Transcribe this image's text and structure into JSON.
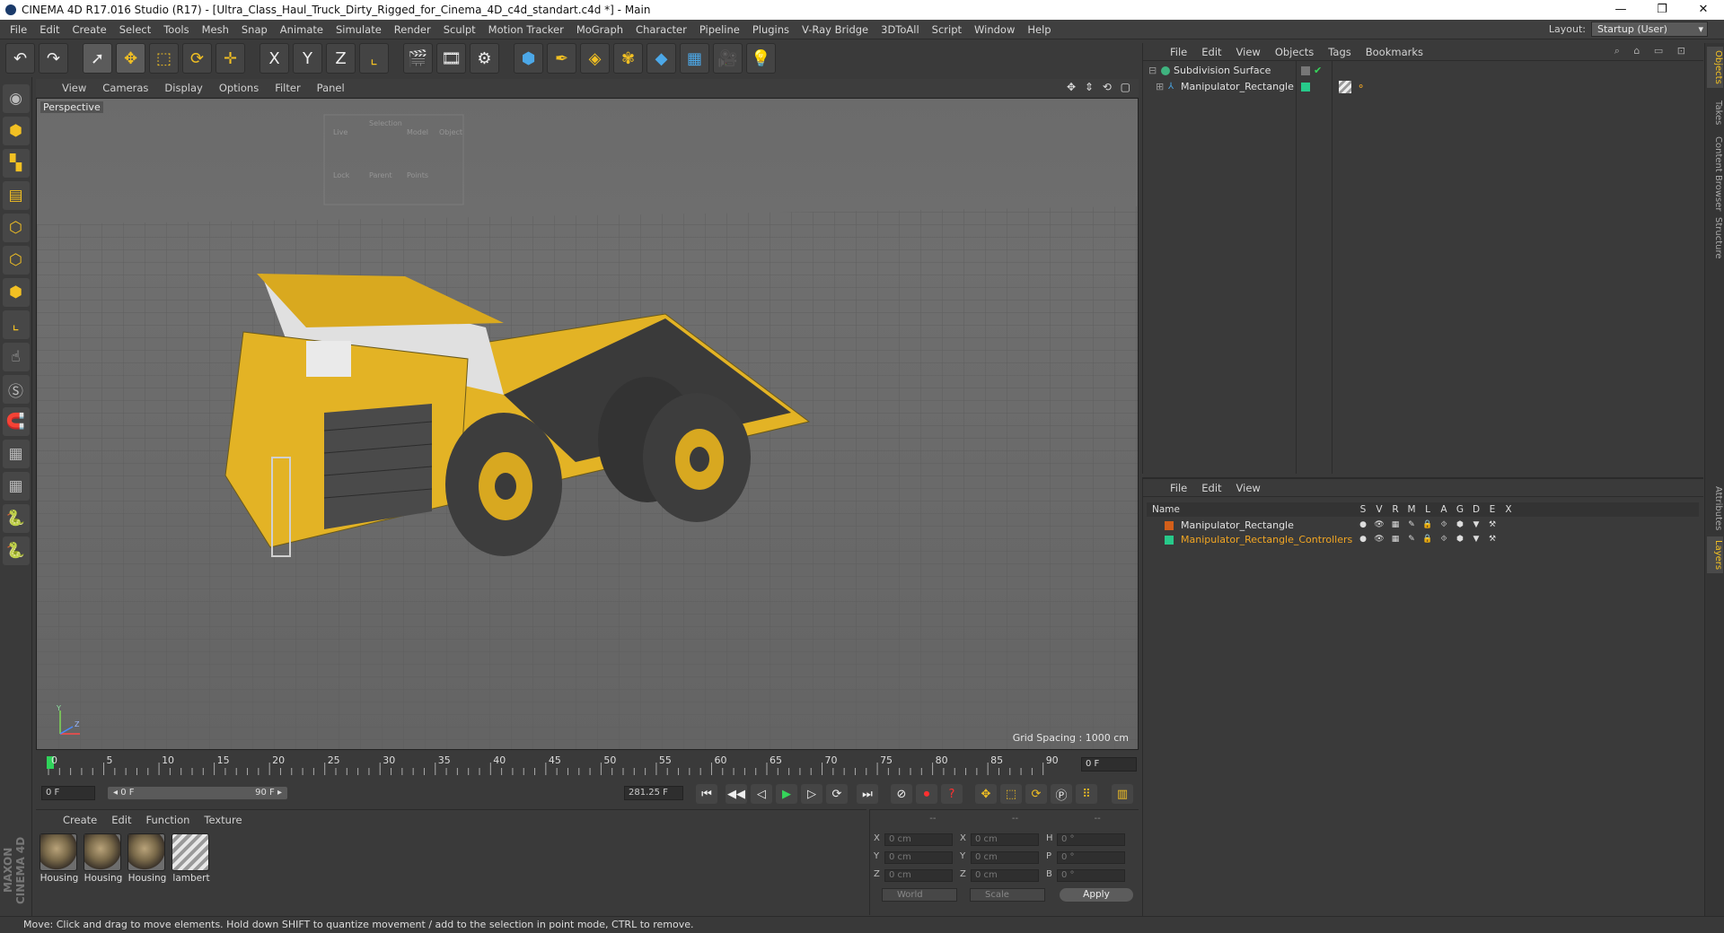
{
  "titlebar": {
    "title": "CINEMA 4D R17.016 Studio (R17) - [Ultra_Class_Haul_Truck_Dirty_Rigged_for_Cinema_4D_c4d_standart.c4d *] - Main",
    "minimize": "—",
    "maximize": "❐",
    "close": "✕"
  },
  "menubar": {
    "items": [
      "File",
      "Edit",
      "Create",
      "Select",
      "Tools",
      "Mesh",
      "Snap",
      "Animate",
      "Simulate",
      "Render",
      "Sculpt",
      "Motion Tracker",
      "MoGraph",
      "Character",
      "Pipeline",
      "Plugins",
      "V-Ray Bridge",
      "3DToAll",
      "Script",
      "Window",
      "Help"
    ],
    "layout_label": "Layout:",
    "layout_value": "Startup (User)"
  },
  "toolbar": {
    "icons": [
      "undo-icon",
      "redo-icon",
      "live-selection-icon",
      "move-icon",
      "scale-icon",
      "rotate-icon",
      "last-tool-icon",
      "x-axis-icon",
      "y-axis-icon",
      "z-axis-icon",
      "coordinate-system-icon",
      "render-view-icon",
      "render-picture-viewer-icon",
      "edit-render-settings-icon",
      "cube-icon",
      "pen-spline-icon",
      "subdivision-icon",
      "cloner-icon",
      "deformer-icon",
      "floor-icon",
      "camera-icon",
      "light-icon"
    ],
    "axis_x": "X",
    "axis_y": "Y",
    "axis_z": "Z"
  },
  "viewport": {
    "menu": [
      "View",
      "Cameras",
      "Display",
      "Options",
      "Filter",
      "Panel"
    ],
    "label": "Perspective",
    "grid_spacing": "Grid Spacing : 1000 cm",
    "nav_icons": "✥ ⇕ ⟲ ▢",
    "body_color": "#e3b325",
    "dark_color": "#3a3a3a",
    "hud_text": {
      "r1": [
        "Live",
        "Selection",
        "Model",
        "Object"
      ],
      "r2": [
        "Lock",
        "Parent",
        "Points"
      ]
    }
  },
  "axis_gizmo": {
    "y": "Y",
    "z": "Z"
  },
  "timeline": {
    "ticks": [
      "0",
      "5",
      "10",
      "15",
      "20",
      "25",
      "30",
      "35",
      "40",
      "45",
      "50",
      "55",
      "60",
      "65",
      "70",
      "75",
      "80",
      "85",
      "90"
    ],
    "end_frame": "0 F"
  },
  "transport": {
    "start_field": "0 F",
    "range_start": "◂ 0 F",
    "range_end": "90 F ▸",
    "fps_field": "281.25 F",
    "buttons": [
      "⏮",
      "◀◀",
      "◁",
      "▶",
      "▷",
      "⟳",
      "⏭"
    ]
  },
  "materials": {
    "menu": [
      "Create",
      "Edit",
      "Function",
      "Texture"
    ],
    "items": [
      "Housing",
      "Housing",
      "Housing",
      "lambert"
    ]
  },
  "coords": {
    "headers": [
      "--",
      "--",
      "--"
    ],
    "rows": [
      {
        "a": "X",
        "v1": "0 cm",
        "b": "X",
        "v2": "0 cm",
        "c": "H",
        "v3": "0 °"
      },
      {
        "a": "Y",
        "v1": "0 cm",
        "b": "Y",
        "v2": "0 cm",
        "c": "P",
        "v3": "0 °"
      },
      {
        "a": "Z",
        "v1": "0 cm",
        "b": "Z",
        "v2": "0 cm",
        "c": "B",
        "v3": "0 °"
      }
    ],
    "world": "World",
    "scale": "Scale",
    "apply": "Apply"
  },
  "status": {
    "text": "Move: Click and drag to move elements. Hold down SHIFT to quantize movement / add to the selection in point mode, CTRL to remove."
  },
  "objects": {
    "menu": [
      "File",
      "Edit",
      "View",
      "Objects",
      "Tags",
      "Bookmarks"
    ],
    "items": [
      {
        "name": "Subdivision Surface",
        "color": "#3fb37f"
      },
      {
        "name": "Manipulator_Rectangle",
        "color": "#4aa3df"
      }
    ]
  },
  "layers": {
    "menu": [
      "File",
      "Edit",
      "View"
    ],
    "header_name": "Name",
    "columns": [
      "S",
      "V",
      "R",
      "M",
      "L",
      "A",
      "G",
      "D",
      "E",
      "X"
    ],
    "rows": [
      {
        "name": "Manipulator_Rectangle",
        "color": "#d35f1a",
        "text_color": "#e0e0e0"
      },
      {
        "name": "Manipulator_Rectangle_Controllers",
        "color": "#27c98a",
        "text_color": "#f2a623"
      }
    ],
    "flags": [
      "●",
      "👁",
      "▦",
      "✎",
      "🔒",
      "⯑",
      "⬢",
      "▼",
      "⚒"
    ]
  },
  "side_tabs": [
    "Objects",
    "Takes",
    "Content Browser",
    "Structure",
    "Attributes",
    "Layers"
  ]
}
